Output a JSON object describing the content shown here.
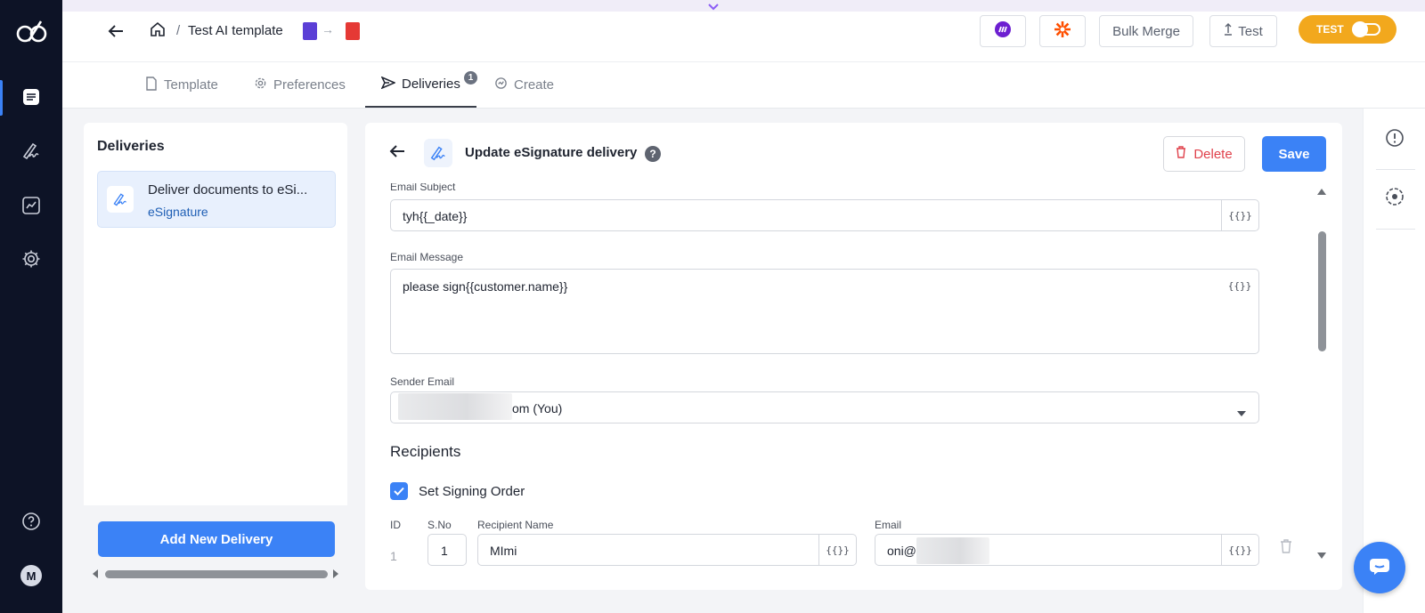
{
  "header": {
    "breadcrumb_separator": "/",
    "title": "Test AI template",
    "arrow": "→",
    "bulk_merge_label": "Bulk Merge",
    "test_label": "Test",
    "toggle_label": "TEST",
    "toggle_color": "#f2a81d"
  },
  "tabs": [
    {
      "label": "Template",
      "icon": "file-icon"
    },
    {
      "label": "Preferences",
      "icon": "gear-icon"
    },
    {
      "label": "Deliveries",
      "icon": "send-icon",
      "badge": "1",
      "active": true
    },
    {
      "label": "Create",
      "icon": "refresh-icon"
    }
  ],
  "sidebar": {
    "title": "Deliveries",
    "items": [
      {
        "title": "Deliver documents to eSi...",
        "subtitle": "eSignature"
      }
    ],
    "add_label": "Add New Delivery"
  },
  "main": {
    "title": "Update eSignature delivery",
    "help": "?",
    "delete_label": "Delete",
    "save_label": "Save"
  },
  "form": {
    "email_subject_label": "Email Subject",
    "email_subject_value": "tyh{{_date}}",
    "email_message_label": "Email Message",
    "email_message_value": "please sign{{customer.name}}",
    "sender_email_label": "Sender Email",
    "sender_email_value": "om (You)",
    "variable_button": "{{}}",
    "recipients_title": "Recipients",
    "signing_order_label": "Set Signing Order",
    "signing_order_checked": true,
    "columns": {
      "id": "ID",
      "sno": "S.No",
      "name": "Recipient Name",
      "email": "Email"
    },
    "recipients": [
      {
        "id": "1",
        "sno": "1",
        "name": "MImi",
        "email": "oni@"
      }
    ]
  },
  "user": {
    "avatar_initial": "M"
  },
  "colors": {
    "primary": "#3b82f6",
    "rail": "#0d1326",
    "danger": "#e0424c"
  }
}
